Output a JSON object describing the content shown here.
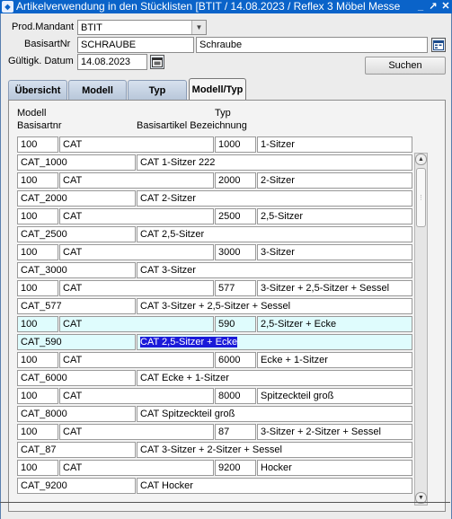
{
  "window": {
    "title": "Artikelverwendung in den Stücklisten   [BTIT / 14.08.2023 / Reflex 3 Möbel Messe",
    "icon_name": "app-icon",
    "controls": [
      "minimize-icon",
      "restore-icon",
      "close-icon"
    ]
  },
  "form": {
    "mandant_label": "Prod.Mandant",
    "mandant_value": "BTIT",
    "basisartnr_label": "BasisartNr",
    "basisartnr_value": "SCHRAUBE",
    "basisartnr_desc": "Schraube",
    "datum_label": "Gültigk. Datum",
    "datum_value": "14.08.2023",
    "search_button": "Suchen"
  },
  "tabs": [
    {
      "label": "Übersicht",
      "active": false
    },
    {
      "label": "Modell",
      "active": false
    },
    {
      "label": "Typ",
      "active": false
    },
    {
      "label": "Modell/Typ",
      "active": true
    }
  ],
  "columns": {
    "modell": "Modell",
    "typ": "Typ",
    "basisartnr": "Basisartnr",
    "bezeichnung": "Basisartikel Bezeichnung"
  },
  "rows": [
    {
      "modell_nr": "100",
      "modell_name": "CAT",
      "typ_nr": "1000",
      "typ_name": "1-Sitzer",
      "artnr": "CAT_1000",
      "bezeichnung": "CAT 1-Sitzer 222"
    },
    {
      "modell_nr": "100",
      "modell_name": "CAT",
      "typ_nr": "2000",
      "typ_name": "2-Sitzer",
      "artnr": "CAT_2000",
      "bezeichnung": "CAT 2-Sitzer"
    },
    {
      "modell_nr": "100",
      "modell_name": "CAT",
      "typ_nr": "2500",
      "typ_name": "2,5-Sitzer",
      "artnr": "CAT_2500",
      "bezeichnung": "CAT 2,5-Sitzer"
    },
    {
      "modell_nr": "100",
      "modell_name": "CAT",
      "typ_nr": "3000",
      "typ_name": "3-Sitzer",
      "artnr": "CAT_3000",
      "bezeichnung": "CAT 3-Sitzer"
    },
    {
      "modell_nr": "100",
      "modell_name": "CAT",
      "typ_nr": "577",
      "typ_name": "3-Sitzer + 2,5-Sitzer + Sessel",
      "artnr": "CAT_577",
      "bezeichnung": "CAT 3-Sitzer + 2,5-Sitzer + Sessel"
    },
    {
      "modell_nr": "100",
      "modell_name": "CAT",
      "typ_nr": "590",
      "typ_name": "2,5-Sitzer + Ecke",
      "artnr": "CAT_590",
      "bezeichnung": "CAT 2,5-Sitzer + Ecke",
      "selected": true
    },
    {
      "modell_nr": "100",
      "modell_name": "CAT",
      "typ_nr": "6000",
      "typ_name": "Ecke + 1-Sitzer",
      "artnr": "CAT_6000",
      "bezeichnung": "CAT Ecke + 1-Sitzer"
    },
    {
      "modell_nr": "100",
      "modell_name": "CAT",
      "typ_nr": "8000",
      "typ_name": "Spitzeckteil groß",
      "artnr": "CAT_8000",
      "bezeichnung": "CAT Spitzeckteil groß"
    },
    {
      "modell_nr": "100",
      "modell_name": "CAT",
      "typ_nr": "87",
      "typ_name": "3-Sitzer + 2-Sitzer + Sessel",
      "artnr": "CAT_87",
      "bezeichnung": "CAT 3-Sitzer + 2-Sitzer + Sessel"
    },
    {
      "modell_nr": "100",
      "modell_name": "CAT",
      "typ_nr": "9200",
      "typ_name": "Hocker",
      "artnr": "CAT_9200",
      "bezeichnung": "CAT Hocker"
    }
  ],
  "colors": {
    "titlebar": "#0a63c9",
    "selected_row": "#dffcfd",
    "highlight": "#1a1ad9"
  }
}
